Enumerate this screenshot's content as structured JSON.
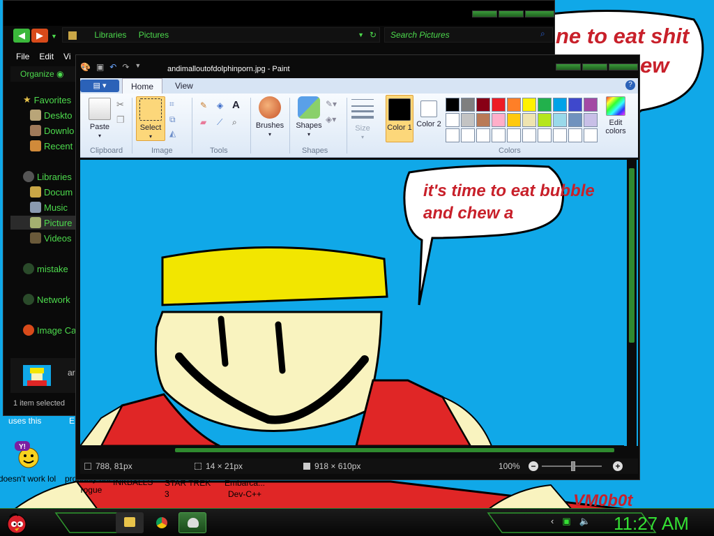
{
  "desktop": {
    "bg_bubble_line1": "ne to eat shit",
    "bg_bubble_line2": "ew",
    "signature": "VM0b0t",
    "label_uses_this": "uses this",
    "label_e": "E",
    "icons": [
      {
        "label": "doesn't work lol"
      },
      {
        "label": "probably not a rogue"
      }
    ],
    "label_inkballs": "INKBALLS",
    "label_startrek": "STAR TREK 3",
    "label_embarca": "Embarca... Dev-C++"
  },
  "explorer": {
    "address": {
      "seg1": "Libraries",
      "seg2": "Pictures"
    },
    "search_placeholder": "Search Pictures",
    "menu": [
      "File",
      "Edit",
      "Vi"
    ],
    "organize": "Organize",
    "nav": {
      "favorites": "Favorites",
      "desktop": "Deskto",
      "downloads": "Downlo",
      "recent": "Recent",
      "libraries": "Libraries",
      "documents": "Docum",
      "music": "Music",
      "pictures": "Picture",
      "videos": "Videos",
      "homegroup": "mistake",
      "network": "Network",
      "image_ca": "Image Ca"
    },
    "details_partial": "ar",
    "status": "1 item selected"
  },
  "paint": {
    "title": "andimalloutofdolphinporn.jpg - Paint",
    "tabs": {
      "home": "Home",
      "view": "View"
    },
    "ribbon": {
      "paste": "Paste",
      "clipboard": "Clipboard",
      "select": "Select",
      "image": "Image",
      "tools": "Tools",
      "brushes": "Brushes",
      "shapes_btn": "Shapes",
      "shapes_group": "Shapes",
      "size": "Size",
      "color1": "Color 1",
      "color2": "Color 2",
      "edit_colors": "Edit colors",
      "colors": "Colors"
    },
    "palette": [
      "#000000",
      "#7f7f7f",
      "#880015",
      "#ed1c24",
      "#ff7f27",
      "#fff200",
      "#22b14c",
      "#00a2e8",
      "#3f48cc",
      "#a349a4",
      "#ffffff",
      "#c3c3c3",
      "#b97a57",
      "#ffaec9",
      "#ffc90e",
      "#efe4b0",
      "#b5e61d",
      "#99d9ea",
      "#7092be",
      "#c8bfe7",
      "#ffffff",
      "#ffffff",
      "#ffffff",
      "#ffffff",
      "#ffffff",
      "#ffffff",
      "#ffffff",
      "#ffffff",
      "#ffffff",
      "#ffffff"
    ],
    "canvas": {
      "bubble_line1": "it's time to eat bubble",
      "bubble_line2": "and chew a"
    },
    "status": {
      "cursor": "788, 81px",
      "selection": "14 × 21px",
      "image_size": "918 × 610px",
      "zoom": "100%"
    }
  },
  "taskbar": {
    "clock": "11:27 AM"
  },
  "colors": {
    "accent_green": "#34e034",
    "sky_blue": "#10a8e8",
    "paint_red": "#c8202a"
  }
}
